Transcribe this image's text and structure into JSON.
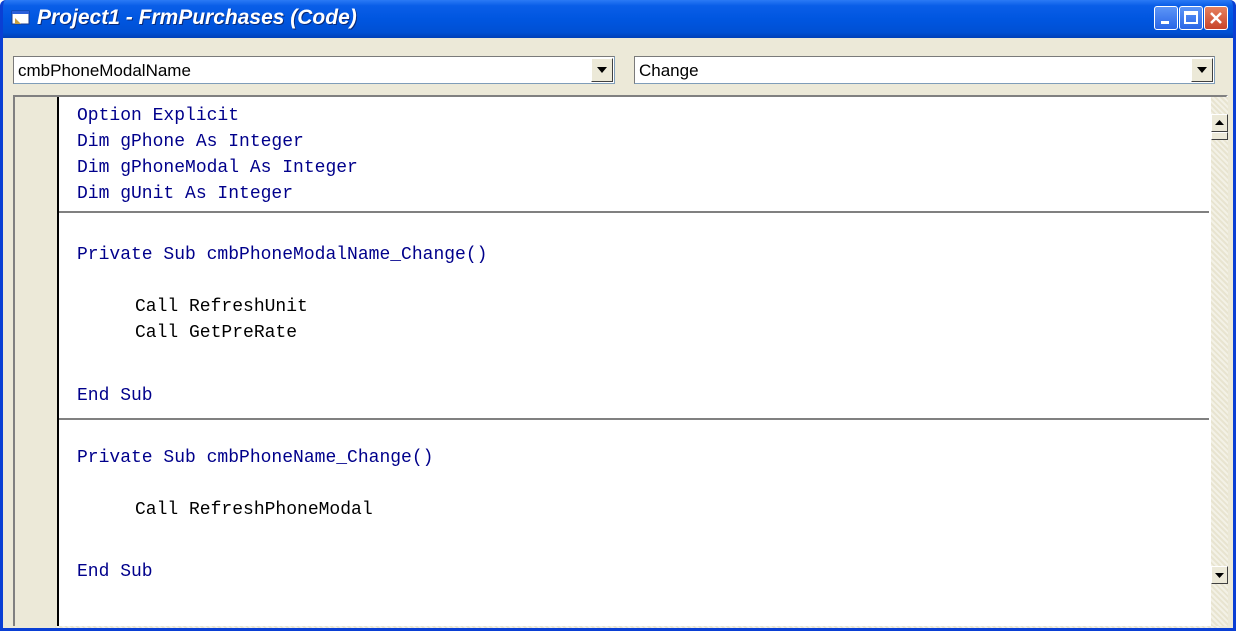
{
  "window": {
    "title": "Project1 - FrmPurchases (Code)",
    "accent_color": "#0054e3",
    "titlebar_icon": "vb-form-icon",
    "controls": [
      "minimize-icon",
      "maximize-icon",
      "close-icon"
    ]
  },
  "object_combo": {
    "value": "cmbPhoneModalName"
  },
  "procedure_combo": {
    "value": "Change"
  },
  "code": {
    "keyword_color": "#00008b",
    "lines": [
      "Option Explicit",
      "Dim gPhone As Integer",
      "Dim gPhoneModal As Integer",
      "Dim gUnit As Integer",
      "Private Sub cmbPhoneModalName_Change()",
      "Call RefreshUnit",
      "Call GetPreRate",
      "End Sub",
      "Private Sub cmbPhoneName_Change()",
      "Call RefreshPhoneModal",
      "End Sub"
    ]
  },
  "footer": {
    "view_buttons": [
      "procedure-view-icon",
      "full-module-view-icon"
    ]
  }
}
